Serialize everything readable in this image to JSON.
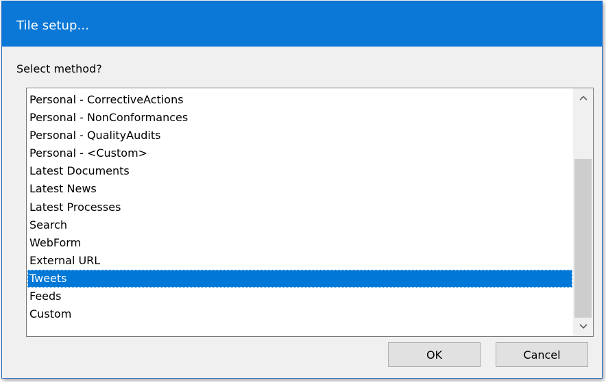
{
  "dialog": {
    "title": "Tile setup...",
    "prompt": "Select method?"
  },
  "method_list": {
    "items": [
      "Personal - CorrectiveActions",
      "Personal - NonConformances",
      "Personal - QualityAudits",
      "Personal - <Custom>",
      "Latest Documents",
      "Latest News",
      "Latest Processes",
      "Search",
      "WebForm",
      "External URL",
      "Tweets",
      "Feeds",
      "Custom"
    ],
    "selected": "Tweets",
    "scroll_up_icon": "chevron-up-icon",
    "scroll_down_icon": "chevron-down-icon"
  },
  "buttons": {
    "ok_label": "OK",
    "cancel_label": "Cancel"
  },
  "colors": {
    "titlebar": "#0b78d7",
    "selection": "#0078d7",
    "window_background": "#f0f0f0",
    "button_face": "#e1e1e1"
  }
}
